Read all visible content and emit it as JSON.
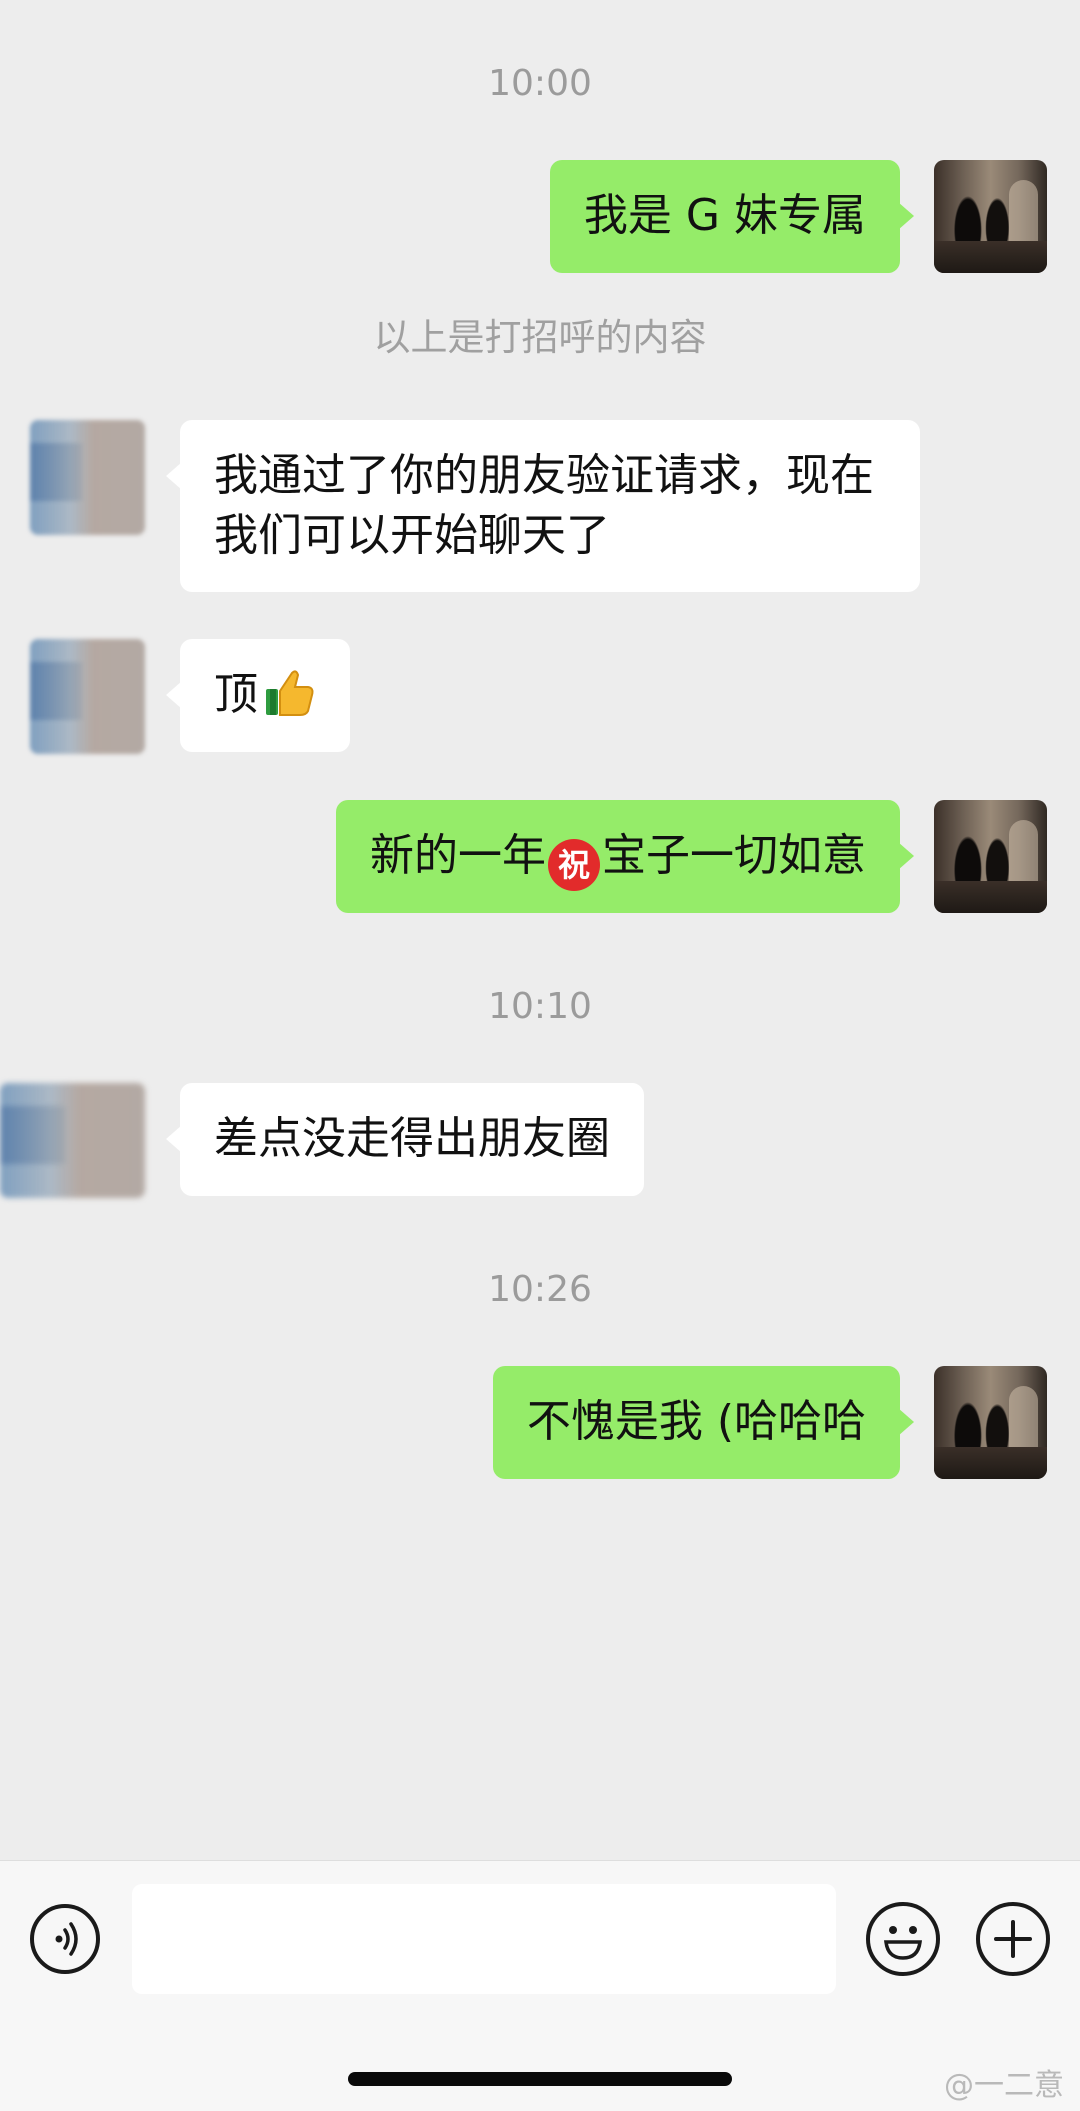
{
  "messages": [
    {
      "type": "time",
      "text": "10:00"
    },
    {
      "type": "me",
      "text": "我是 G 妹专属"
    },
    {
      "type": "system",
      "text": "以上是打招呼的内容"
    },
    {
      "type": "other",
      "text": "我通过了你的朋友验证请求，现在我们可以开始聊天了"
    },
    {
      "type": "other",
      "text": "顶",
      "emoji": "thumbs-up"
    },
    {
      "type": "me",
      "text_before": "新的一年",
      "emoji_text": "祝",
      "text_after": "宝子一切如意"
    },
    {
      "type": "time",
      "text": "10:10"
    },
    {
      "type": "other",
      "text": "差点没走得出朋友圈"
    },
    {
      "type": "time",
      "text": "10:26"
    },
    {
      "type": "me",
      "text": "不愧是我 (哈哈哈"
    }
  ],
  "input_bar": {
    "voice_icon": "voice-icon",
    "emoji_icon": "emoji-icon",
    "plus_icon": "plus-icon",
    "placeholder": ""
  },
  "watermark": "@一二意",
  "colors": {
    "background": "#ededed",
    "my_bubble": "#95ec69",
    "other_bubble": "#ffffff",
    "timestamp": "#9b9b9b"
  }
}
